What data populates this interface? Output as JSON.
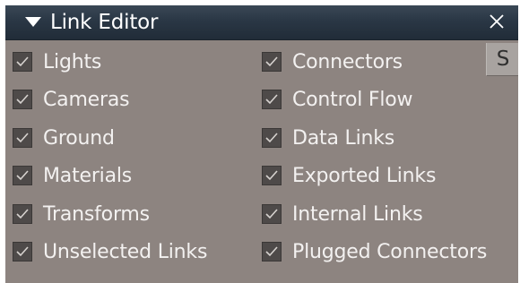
{
  "window": {
    "title": "Link Editor",
    "side_button_label": "S"
  },
  "options_left": [
    {
      "label": "Lights",
      "checked": true
    },
    {
      "label": "Cameras",
      "checked": true
    },
    {
      "label": "Ground",
      "checked": true
    },
    {
      "label": "Materials",
      "checked": true
    },
    {
      "label": "Transforms",
      "checked": true
    },
    {
      "label": "Unselected Links",
      "checked": true
    }
  ],
  "options_right": [
    {
      "label": "Connectors",
      "checked": true
    },
    {
      "label": "Control Flow",
      "checked": true
    },
    {
      "label": "Data Links",
      "checked": true
    },
    {
      "label": "Exported Links",
      "checked": true
    },
    {
      "label": "Internal Links",
      "checked": true
    },
    {
      "label": "Plugged Connectors",
      "checked": true
    }
  ],
  "icons": {
    "collapse": "triangle-down-icon",
    "close": "close-icon",
    "check": "checkmark-icon"
  },
  "colors": {
    "panel_bg": "#8d8480",
    "titlebar_bg": "#2a3745",
    "checkbox_bg": "#4e4a49",
    "label_text": "#f3f1f0"
  }
}
